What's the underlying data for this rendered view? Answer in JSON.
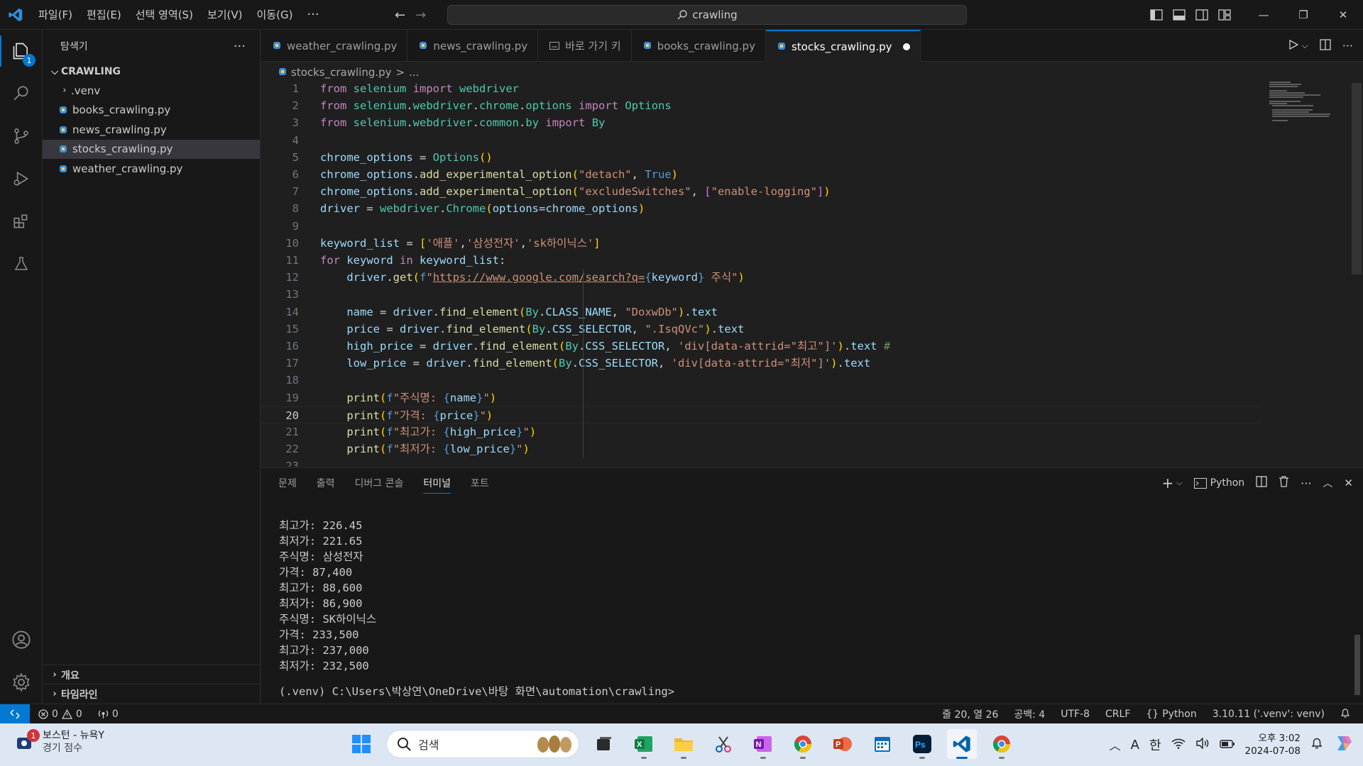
{
  "titlebar": {
    "menus": [
      "파일(F)",
      "편집(E)",
      "선택 영역(S)",
      "보기(V)",
      "이동(G)"
    ],
    "more": "···",
    "search_text": "crawling"
  },
  "activity": {
    "explorer_badge": "1"
  },
  "sidebar": {
    "title": "탐색기",
    "more": "···",
    "folder": "CRAWLING",
    "items": [
      {
        "label": ".venv"
      },
      {
        "label": "books_crawling.py"
      },
      {
        "label": "news_crawling.py"
      },
      {
        "label": "stocks_crawling.py"
      },
      {
        "label": "weather_crawling.py"
      }
    ],
    "outline": "개요",
    "timeline": "타임라인"
  },
  "tabs": [
    {
      "label": "weather_crawling.py"
    },
    {
      "label": "news_crawling.py"
    },
    {
      "label": "바로 가기 키"
    },
    {
      "label": "books_crawling.py"
    },
    {
      "label": "stocks_crawling.py"
    }
  ],
  "breadcrumb": {
    "file": "stocks_crawling.py",
    "sep": ">",
    "rest": "..."
  },
  "editor": {
    "current_line": 20,
    "lines": [
      [
        [
          "kw",
          "from"
        ],
        [
          "def",
          " "
        ],
        [
          "cls",
          "selenium"
        ],
        [
          "def",
          " "
        ],
        [
          "kw",
          "import"
        ],
        [
          "def",
          " "
        ],
        [
          "cls",
          "webdriver"
        ]
      ],
      [
        [
          "kw",
          "from"
        ],
        [
          "def",
          " "
        ],
        [
          "cls",
          "selenium"
        ],
        [
          "def",
          "."
        ],
        [
          "cls",
          "webdriver"
        ],
        [
          "def",
          "."
        ],
        [
          "cls",
          "chrome"
        ],
        [
          "def",
          "."
        ],
        [
          "cls",
          "options"
        ],
        [
          "def",
          " "
        ],
        [
          "kw",
          "import"
        ],
        [
          "def",
          " "
        ],
        [
          "cls",
          "Options"
        ]
      ],
      [
        [
          "kw",
          "from"
        ],
        [
          "def",
          " "
        ],
        [
          "cls",
          "selenium"
        ],
        [
          "def",
          "."
        ],
        [
          "cls",
          "webdriver"
        ],
        [
          "def",
          "."
        ],
        [
          "cls",
          "common"
        ],
        [
          "def",
          "."
        ],
        [
          "cls",
          "by"
        ],
        [
          "def",
          " "
        ],
        [
          "kw",
          "import"
        ],
        [
          "def",
          " "
        ],
        [
          "cls",
          "By"
        ]
      ],
      [],
      [
        [
          "var",
          "chrome_options"
        ],
        [
          "def",
          " = "
        ],
        [
          "cls",
          "Options"
        ],
        [
          "br1",
          "()"
        ]
      ],
      [
        [
          "var",
          "chrome_options"
        ],
        [
          "def",
          "."
        ],
        [
          "fn",
          "add_experimental_option"
        ],
        [
          "br1",
          "("
        ],
        [
          "str",
          "\"detach\""
        ],
        [
          "def",
          ", "
        ],
        [
          "const",
          "True"
        ],
        [
          "br1",
          ")"
        ]
      ],
      [
        [
          "var",
          "chrome_options"
        ],
        [
          "def",
          "."
        ],
        [
          "fn",
          "add_experimental_option"
        ],
        [
          "br1",
          "("
        ],
        [
          "str",
          "\"excludeSwitches\""
        ],
        [
          "def",
          ", "
        ],
        [
          "br2",
          "["
        ],
        [
          "str",
          "\"enable-logging\""
        ],
        [
          "br2",
          "]"
        ],
        [
          "br1",
          ")"
        ]
      ],
      [
        [
          "var",
          "driver"
        ],
        [
          "def",
          " = "
        ],
        [
          "cls",
          "webdriver"
        ],
        [
          "def",
          "."
        ],
        [
          "cls",
          "Chrome"
        ],
        [
          "br1",
          "("
        ],
        [
          "var",
          "options"
        ],
        [
          "def",
          "="
        ],
        [
          "var",
          "chrome_options"
        ],
        [
          "br1",
          ")"
        ]
      ],
      [],
      [
        [
          "var",
          "keyword_list"
        ],
        [
          "def",
          " = "
        ],
        [
          "br1",
          "["
        ],
        [
          "str",
          "'애플'"
        ],
        [
          "def",
          ","
        ],
        [
          "str",
          "'삼성전자'"
        ],
        [
          "def",
          ","
        ],
        [
          "str",
          "'sk하이닉스'"
        ],
        [
          "br1",
          "]"
        ]
      ],
      [
        [
          "kw",
          "for"
        ],
        [
          "def",
          " "
        ],
        [
          "var",
          "keyword"
        ],
        [
          "def",
          " "
        ],
        [
          "kw",
          "in"
        ],
        [
          "def",
          " "
        ],
        [
          "var",
          "keyword_list"
        ],
        [
          "def",
          ":"
        ]
      ],
      [
        [
          "def",
          "    "
        ],
        [
          "var",
          "driver"
        ],
        [
          "def",
          "."
        ],
        [
          "fn",
          "get"
        ],
        [
          "br1",
          "("
        ],
        [
          "const",
          "f"
        ],
        [
          "str",
          "\""
        ],
        [
          "url",
          "https://www.google.com/search?q="
        ],
        [
          "const",
          "{"
        ],
        [
          "var",
          "keyword"
        ],
        [
          "const",
          "}"
        ],
        [
          "str",
          " 주식\""
        ],
        [
          "br1",
          ")"
        ]
      ],
      [],
      [
        [
          "def",
          "    "
        ],
        [
          "var",
          "name"
        ],
        [
          "def",
          " = "
        ],
        [
          "var",
          "driver"
        ],
        [
          "def",
          "."
        ],
        [
          "fn",
          "find_element"
        ],
        [
          "br1",
          "("
        ],
        [
          "cls",
          "By"
        ],
        [
          "def",
          "."
        ],
        [
          "var",
          "CLASS_NAME"
        ],
        [
          "def",
          ", "
        ],
        [
          "str",
          "\"DoxwDb\""
        ],
        [
          "br1",
          ")"
        ],
        [
          "def",
          "."
        ],
        [
          "var",
          "text"
        ]
      ],
      [
        [
          "def",
          "    "
        ],
        [
          "var",
          "price"
        ],
        [
          "def",
          " = "
        ],
        [
          "var",
          "driver"
        ],
        [
          "def",
          "."
        ],
        [
          "fn",
          "find_element"
        ],
        [
          "br1",
          "("
        ],
        [
          "cls",
          "By"
        ],
        [
          "def",
          "."
        ],
        [
          "var",
          "CSS_SELECTOR"
        ],
        [
          "def",
          ", "
        ],
        [
          "str",
          "\".IsqQVc\""
        ],
        [
          "br1",
          ")"
        ],
        [
          "def",
          "."
        ],
        [
          "var",
          "text"
        ]
      ],
      [
        [
          "def",
          "    "
        ],
        [
          "var",
          "high_price"
        ],
        [
          "def",
          " = "
        ],
        [
          "var",
          "driver"
        ],
        [
          "def",
          "."
        ],
        [
          "fn",
          "find_element"
        ],
        [
          "br1",
          "("
        ],
        [
          "cls",
          "By"
        ],
        [
          "def",
          "."
        ],
        [
          "var",
          "CSS_SELECTOR"
        ],
        [
          "def",
          ", "
        ],
        [
          "str",
          "'div[data-attrid=\"최고\"]'"
        ],
        [
          "br1",
          ")"
        ],
        [
          "def",
          "."
        ],
        [
          "var",
          "text"
        ],
        [
          "def",
          " "
        ],
        [
          "cmt",
          "#"
        ]
      ],
      [
        [
          "def",
          "    "
        ],
        [
          "var",
          "low_price"
        ],
        [
          "def",
          " = "
        ],
        [
          "var",
          "driver"
        ],
        [
          "def",
          "."
        ],
        [
          "fn",
          "find_element"
        ],
        [
          "br1",
          "("
        ],
        [
          "cls",
          "By"
        ],
        [
          "def",
          "."
        ],
        [
          "var",
          "CSS_SELECTOR"
        ],
        [
          "def",
          ", "
        ],
        [
          "str",
          "'div[data-attrid=\"최저\"]'"
        ],
        [
          "br1",
          ")"
        ],
        [
          "def",
          "."
        ],
        [
          "var",
          "text"
        ]
      ],
      [],
      [
        [
          "def",
          "    "
        ],
        [
          "fn",
          "print"
        ],
        [
          "br1",
          "("
        ],
        [
          "const",
          "f"
        ],
        [
          "str",
          "\"주식명: "
        ],
        [
          "const",
          "{"
        ],
        [
          "var",
          "name"
        ],
        [
          "const",
          "}"
        ],
        [
          "str",
          "\""
        ],
        [
          "br1",
          ")"
        ]
      ],
      [
        [
          "def",
          "    "
        ],
        [
          "fn",
          "print"
        ],
        [
          "br1",
          "("
        ],
        [
          "const",
          "f"
        ],
        [
          "str",
          "\"가격: "
        ],
        [
          "const",
          "{"
        ],
        [
          "var",
          "price"
        ],
        [
          "const",
          "}"
        ],
        [
          "str",
          "\""
        ],
        [
          "br1",
          ")"
        ]
      ],
      [
        [
          "def",
          "    "
        ],
        [
          "fn",
          "print"
        ],
        [
          "br1",
          "("
        ],
        [
          "const",
          "f"
        ],
        [
          "str",
          "\"최고가: "
        ],
        [
          "const",
          "{"
        ],
        [
          "var",
          "high_price"
        ],
        [
          "const",
          "}"
        ],
        [
          "str",
          "\""
        ],
        [
          "br1",
          ")"
        ]
      ],
      [
        [
          "def",
          "    "
        ],
        [
          "fn",
          "print"
        ],
        [
          "br1",
          "("
        ],
        [
          "const",
          "f"
        ],
        [
          "str",
          "\"최저가: "
        ],
        [
          "const",
          "{"
        ],
        [
          "var",
          "low_price"
        ],
        [
          "const",
          "}"
        ],
        [
          "str",
          "\""
        ],
        [
          "br1",
          ")"
        ]
      ],
      []
    ]
  },
  "panel": {
    "tabs": [
      "문제",
      "출력",
      "디버그 콘솔",
      "터미널",
      "포트"
    ],
    "active_tab": "터미널",
    "shell": "Python",
    "output": [
      "최고가: 226.45",
      "최저가: 221.65",
      "주식명: 삼성전자",
      "가격: 87,400",
      "최고가: 88,600",
      "최저가: 86,900",
      "주식명: SK하이닉스",
      "가격: 233,500",
      "최고가: 237,000",
      "최저가: 232,500"
    ],
    "prompt": "(.venv) C:\\Users\\박상연\\OneDrive\\바탕 화면\\automation\\crawling>"
  },
  "statusbar": {
    "errors": "0",
    "warnings": "0",
    "ports": "0",
    "position": "줄 20, 열 26",
    "spaces": "공백: 4",
    "encoding": "UTF-8",
    "eol": "CRLF",
    "language": "Python",
    "interpreter": "3.10.11 ('.venv': venv)"
  },
  "taskbar": {
    "weather_title": "보스턴 - 뉴욕Y",
    "weather_sub": "경기 점수",
    "weather_badge": "1",
    "search_placeholder": "검색",
    "ime_a": "A",
    "ime_han": "한",
    "time": "오후 3:02",
    "date": "2024-07-08"
  }
}
